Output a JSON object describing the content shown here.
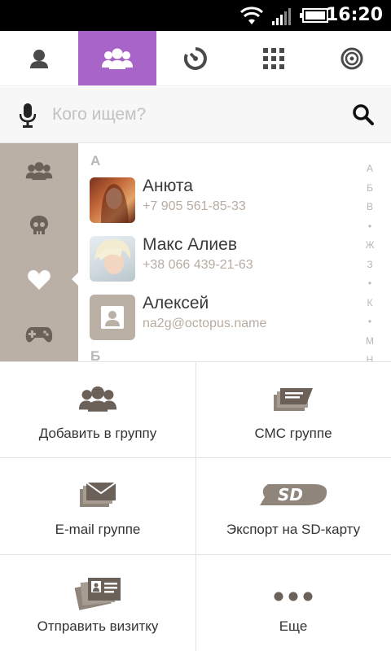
{
  "status_bar": {
    "time": "16:20"
  },
  "tabs": [
    {
      "name": "contact",
      "active": false
    },
    {
      "name": "groups",
      "active": true
    },
    {
      "name": "recent",
      "active": false
    },
    {
      "name": "dialpad",
      "active": false
    },
    {
      "name": "settings",
      "active": false
    }
  ],
  "search": {
    "placeholder": "Кого ищем?"
  },
  "sections": [
    {
      "letter": "А"
    },
    {
      "letter": "Б"
    }
  ],
  "contacts": [
    {
      "name": "Анюта",
      "detail": "+7 905 561-85-33"
    },
    {
      "name": "Макс Алиев",
      "detail": "+38 066 439-21-63"
    },
    {
      "name": "Алексей",
      "detail": "na2g@octopus.name"
    }
  ],
  "alphabet_index": [
    "А",
    "Б",
    "В",
    "•",
    "Ж",
    "З",
    "•",
    "К",
    "•",
    "М",
    "Н"
  ],
  "actions": [
    {
      "label": "Добавить в группу",
      "icon": "add-to-group-icon"
    },
    {
      "label": "СМС группе",
      "icon": "sms-group-icon"
    },
    {
      "label": "E-mail группе",
      "icon": "email-group-icon"
    },
    {
      "label": "Экспорт на SD-карту",
      "icon": "sd-card-icon"
    },
    {
      "label": "Отправить визитку",
      "icon": "business-card-icon"
    },
    {
      "label": "Еще",
      "icon": "more-icon"
    }
  ],
  "colors": {
    "accent": "#a865c9",
    "rail": "#bab0a5"
  }
}
